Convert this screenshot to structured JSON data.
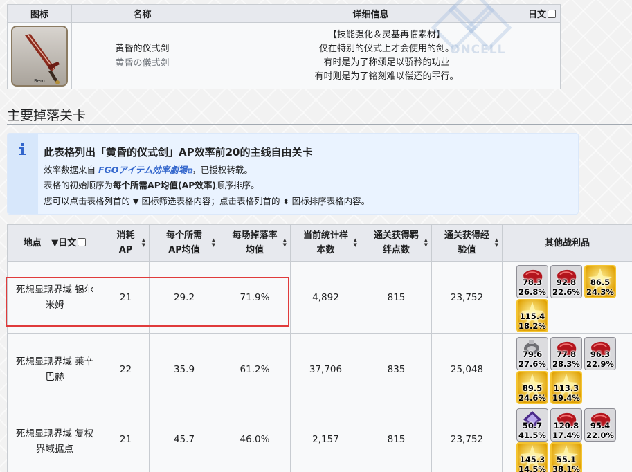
{
  "item_table": {
    "headers": {
      "icon": "图标",
      "name": "名称",
      "detail": "详细信息",
      "jp_toggle": "日文"
    },
    "item": {
      "icon_label": "Rem",
      "name_cn": "黄昏的仪式剑",
      "name_jp": "黄昏の儀式剣",
      "detail_lines": [
        "【技能强化＆灵基再临素材】",
        "仅在特别的仪式上才会使用的剑。",
        "有时是为了称颂足以骄矜的功业",
        "有时则是为了铭刻难以偿还的罪行。"
      ]
    }
  },
  "watermark": "ONCELL",
  "section_heading": "主要掉落关卡",
  "notice": {
    "title": "此表格列出「黄昏的仪式剑」AP效率前20的主线自由关卡",
    "line1_prefix": "效率数据来自",
    "line1_link": "FGOアイテム効率劇場",
    "line1_suffix": "，已授权转载。",
    "line2_prefix": "表格的初始顺序为",
    "line2_bold": "每个所需AP均值(AP效率)",
    "line2_suffix": "顺序排序。",
    "line3_a": "您可以点击表格列首的",
    "line3_b": "图标筛选表格内容；点击表格列首的",
    "line3_c": "图标排序表格内容。"
  },
  "drop_table": {
    "headers": {
      "location": "地点",
      "jp": "日文",
      "ap_l1": "消耗",
      "ap_l2": "AP",
      "avg_l1": "每个所需",
      "avg_l2": "AP均值",
      "rate_l1": "每场掉落率",
      "rate_l2": "均值",
      "samples_l1": "当前统计样",
      "samples_l2": "本数",
      "bond_l1": "通关获得羁",
      "bond_l2": "绊点数",
      "exp_l1": "通关获得经",
      "exp_l2": "验值",
      "other": "其他战利品"
    },
    "rows": [
      {
        "loc_l1": "死想显现界域 锡尔",
        "loc_l2": "米姆",
        "ap": "21",
        "ap_avg": "29.2",
        "drop_rate": "71.9%",
        "samples": "4,892",
        "bond": "815",
        "exp": "23,752",
        "drops": [
          {
            "kind": "red",
            "v1": "78.3",
            "v2": "26.8%"
          },
          {
            "kind": "red",
            "v1": "92.8",
            "v2": "22.6%"
          },
          {
            "kind": "gold",
            "v1": "86.5",
            "v2": "24.3%"
          },
          {
            "kind": "gold",
            "v1": "115.4",
            "v2": "18.2%"
          }
        ]
      },
      {
        "loc_l1": "死想显现界域 莱辛",
        "loc_l2": "巴赫",
        "ap": "22",
        "ap_avg": "35.9",
        "drop_rate": "61.2%",
        "samples": "37,706",
        "bond": "835",
        "exp": "25,048",
        "drops": [
          {
            "kind": "silver",
            "v1": "79.6",
            "v2": "27.6%"
          },
          {
            "kind": "red",
            "v1": "77.8",
            "v2": "28.3%"
          },
          {
            "kind": "red",
            "v1": "96.3",
            "v2": "22.9%"
          },
          {
            "kind": "gold",
            "v1": "89.5",
            "v2": "24.6%"
          },
          {
            "kind": "gold",
            "v1": "113.3",
            "v2": "19.4%"
          }
        ]
      },
      {
        "loc_l1": "死想显现界域 复权",
        "loc_l2": "界域据点",
        "ap": "21",
        "ap_avg": "45.7",
        "drop_rate": "46.0%",
        "samples": "2,157",
        "bond": "815",
        "exp": "23,752",
        "drops": [
          {
            "kind": "purple",
            "v1": "50.7",
            "v2": "41.5%"
          },
          {
            "kind": "red",
            "v1": "120.8",
            "v2": "17.4%"
          },
          {
            "kind": "red",
            "v1": "95.4",
            "v2": "22.0%"
          },
          {
            "kind": "gold",
            "v1": "145.3",
            "v2": "14.5%"
          },
          {
            "kind": "gold",
            "v1": "55.1",
            "v2": "38.1%"
          }
        ]
      }
    ]
  }
}
